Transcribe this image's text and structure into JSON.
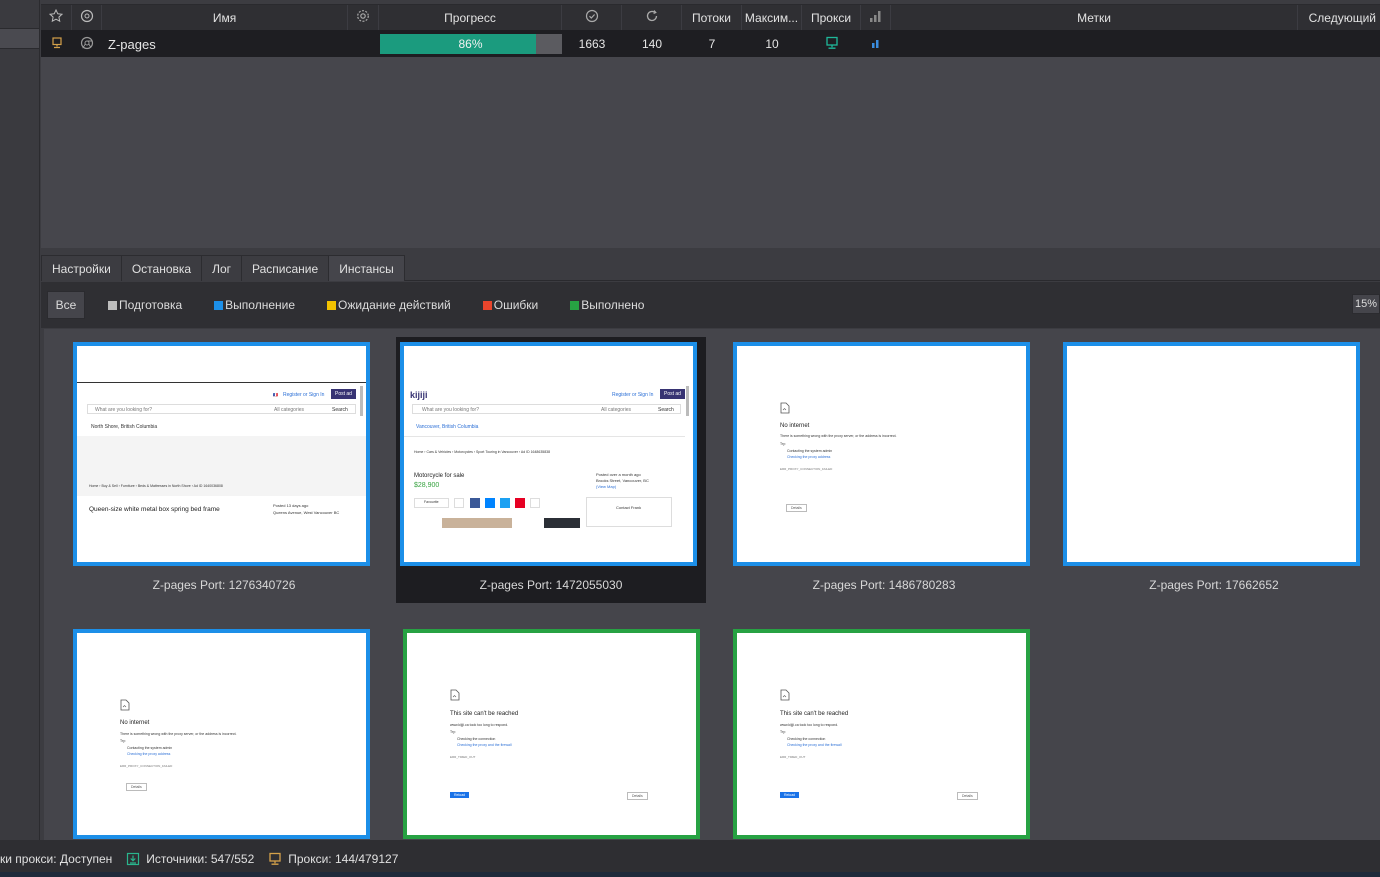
{
  "table": {
    "headers": {
      "name": "Имя",
      "progress": "Прогресс",
      "threads": "Потоки",
      "max": "Максим...",
      "proxy": "Прокси",
      "tags": "Метки",
      "next": "Следующий"
    },
    "rows": [
      {
        "name": "Z-pages",
        "progress": 0.86,
        "progress_label": "86%",
        "success": "1663",
        "retries": "140",
        "threads": "7",
        "max": "10"
      }
    ]
  },
  "tabs": [
    "Настройки",
    "Остановка",
    "Лог",
    "Расписание",
    "Инстансы"
  ],
  "filters": {
    "all": "Все",
    "items": [
      {
        "label": "Подготовка",
        "color": "#bdbdbd"
      },
      {
        "label": "Выполнение",
        "color": "#1c8fe8"
      },
      {
        "label": "Ожидание действий",
        "color": "#f2c200"
      },
      {
        "label": "Ошибки",
        "color": "#e8452c"
      },
      {
        "label": "Выполнено",
        "color": "#27a243"
      }
    ],
    "zoom": "15%"
  },
  "instances": [
    {
      "label": "Z-pages Port: 1276340726",
      "status": "running"
    },
    {
      "label": "Z-pages Port: 1472055030",
      "status": "running",
      "selected": true
    },
    {
      "label": "Z-pages Port: 1486780283",
      "status": "running"
    },
    {
      "label": "Z-pages Port: 17662652",
      "status": "running"
    },
    {
      "label": "",
      "status": "running"
    },
    {
      "label": "",
      "status": "done"
    },
    {
      "label": "",
      "status": "done"
    }
  ],
  "thumbs": {
    "kijiji1": {
      "register": "Register or Sign In",
      "post_ad": "Post ad",
      "search_placeholder": "What are you looking for?",
      "categories": "All categories",
      "search": "Search",
      "location": "North Shore, British Columbia",
      "breadcrumb": "Home › Buy & Sell › Furniture › Beds & Mattresses in North Shore › Ad ID 1640036808",
      "title": "Queen-size white metal box spring bed frame",
      "posted": "Posted 13 days ago",
      "address": "Queens Avenue, West Vancouver BC"
    },
    "kijiji2": {
      "logo": "kijiji",
      "register": "Register or Sign In",
      "post_ad": "Post ad",
      "search_placeholder": "What are you looking for?",
      "categories": "All categories",
      "search": "Search",
      "location": "Vancouver, British Columbia",
      "breadcrumb": "Home › Cars & Vehicles › Motorcycles › Sport Touring in Vancouver › Ad ID 1648635838",
      "title": "Motorcycle for sale",
      "price": "$28,900",
      "posted": "Posted over a month ago",
      "address": "Brooks Street, Vancouver, BC",
      "view_map": "(View Map)",
      "save": "Favourite",
      "contact": "Contact Frank"
    },
    "no_internet": {
      "title": "No internet",
      "desc": "There is something wrong with the proxy server, or the address is incorrect.",
      "try": "Try:",
      "tip1": "Contacting the system admin",
      "tip2": "Checking the proxy address",
      "code": "ERR_PROXY_CONNECTION_FAILED",
      "details": "Details"
    },
    "unreachable": {
      "title": "This site can't be reached",
      "desc": "www.kijiji.ca took too long to respond.",
      "try": "Try:",
      "tip1": "Checking the connection",
      "tip2": "Checking the proxy and the firewall",
      "code": "ERR_TIMED_OUT",
      "reload": "Reload",
      "details": "Details"
    }
  },
  "status_bar": {
    "proxy_check": "ки прокси: Доступен",
    "sources": "Источники: 547/552",
    "proxies": "Прокси: 144/479127"
  },
  "colors": {
    "running": "#1c8fe8",
    "done": "#27a243",
    "progress": "#1b9b7e"
  }
}
